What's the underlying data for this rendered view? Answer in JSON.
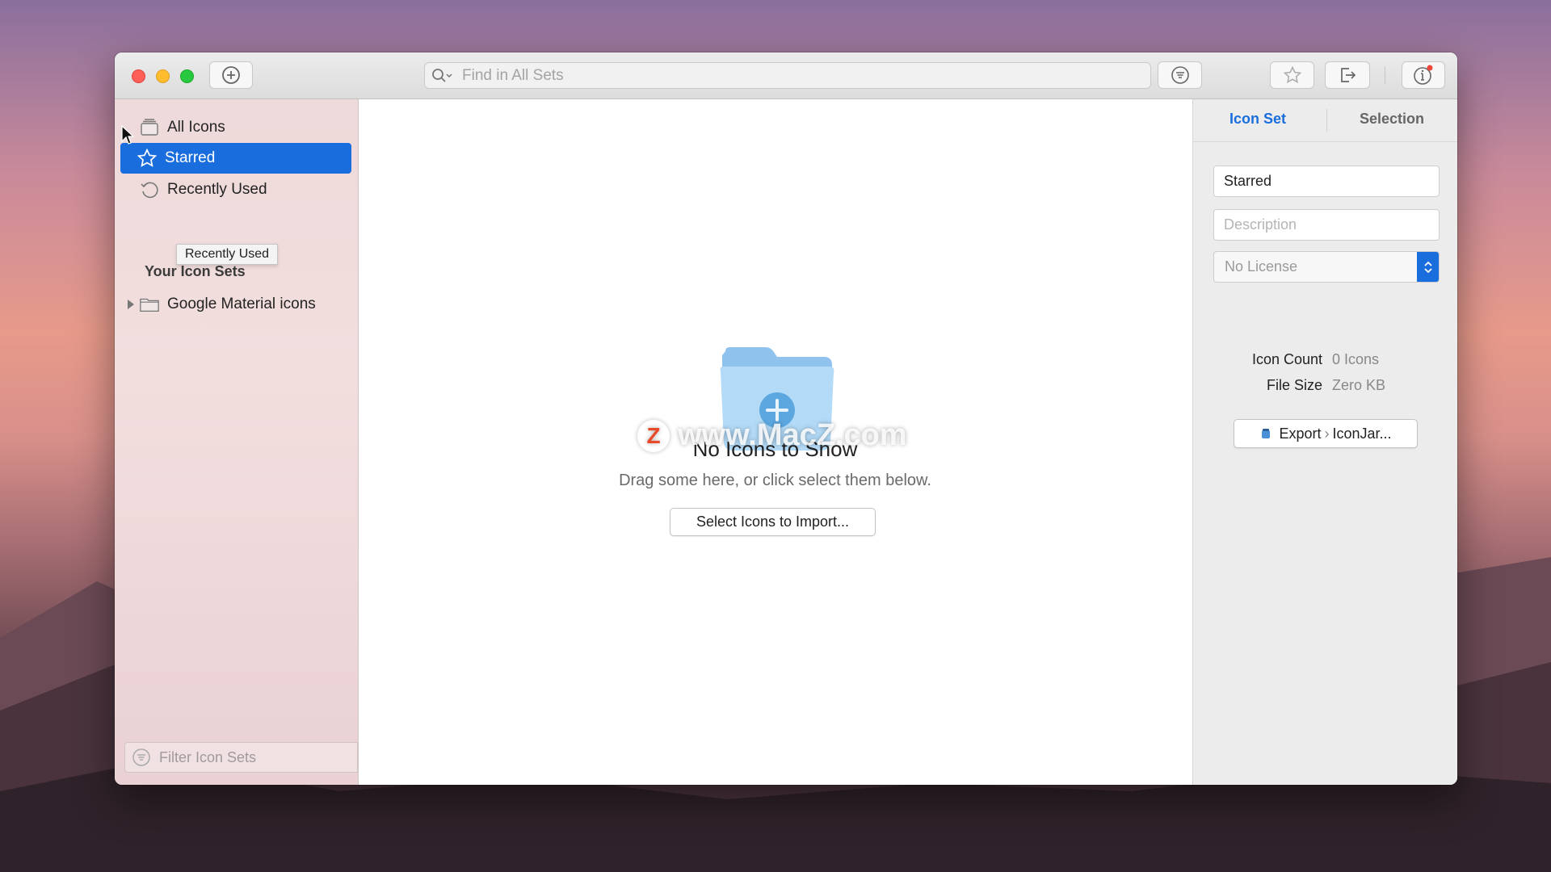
{
  "toolbar": {
    "add_icon": "plus-circle-icon",
    "search_placeholder": "Find in All Sets",
    "filter_icon": "filter-icon",
    "star_icon": "star-icon",
    "share_icon": "share-icon",
    "info_icon": "info-icon"
  },
  "sidebar": {
    "items": [
      {
        "label": "All Icons",
        "icon": "stack-icon"
      },
      {
        "label": "Starred",
        "icon": "star-icon",
        "selected": true
      },
      {
        "label": "Recently Used",
        "icon": "history-icon"
      }
    ],
    "tooltip": "Recently Used",
    "section_title": "Your Icon Sets",
    "sets": [
      {
        "label": "Google Material icons",
        "icon": "folder-icon"
      }
    ],
    "filter_placeholder": "Filter Icon Sets"
  },
  "main": {
    "empty_title": "No Icons to Show",
    "empty_subtitle": "Drag some here, or click select them below.",
    "import_button": "Select Icons to Import...",
    "watermark": "www.MacZ.com",
    "watermark_logo": "Z"
  },
  "inspector": {
    "tabs": [
      "Icon Set",
      "Selection"
    ],
    "name_value": "Starred",
    "description_placeholder": "Description",
    "license_value": "No License",
    "icon_count_label": "Icon Count",
    "icon_count_value": "0 Icons",
    "file_size_label": "File Size",
    "file_size_value": "Zero KB",
    "export_label": "Export",
    "export_target": "IconJar..."
  },
  "colors": {
    "accent": "#1a6ddc",
    "folder": "#a9d4f5"
  }
}
